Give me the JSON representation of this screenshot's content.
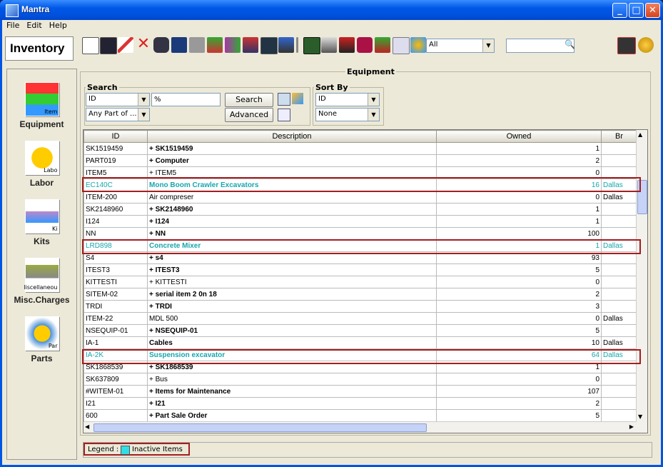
{
  "window": {
    "title": "Mantra",
    "min": "_",
    "max": "□",
    "close": "✕"
  },
  "menu": [
    "File",
    "Edit",
    "Help"
  ],
  "header": {
    "module_label": "Inventory",
    "filter_value": "All",
    "search_value": ""
  },
  "sidebar": [
    {
      "label": "Equipment",
      "icon_text": "Item",
      "icon": "equipment-icon"
    },
    {
      "label": "Labor",
      "icon_text": "Labo",
      "icon": "labor-icon"
    },
    {
      "label": "Kits",
      "icon_text": "Ki",
      "icon": "kits-icon"
    },
    {
      "label": "Misc.Charges",
      "icon_text": "liscellaneou",
      "icon": "misc-charges-icon"
    },
    {
      "label": "Parts",
      "icon_text": "Par",
      "icon": "parts-icon"
    }
  ],
  "panel": {
    "title": "Equipment",
    "search": {
      "title": "Search",
      "field": "ID",
      "value": "%",
      "match": "Any Part of ...",
      "search_button": "Search",
      "advanced_button": "Advanced"
    },
    "sort": {
      "title": "Sort By",
      "first": "ID",
      "second": "None"
    }
  },
  "table": {
    "columns": [
      "ID",
      "Description",
      "Owned",
      "Br"
    ],
    "rows": [
      {
        "id": "SK1519459",
        "desc": "+ SK1519459",
        "owned": "1",
        "br": "",
        "bold": true,
        "inactive": false
      },
      {
        "id": "PART019",
        "desc": "+ Computer",
        "owned": "2",
        "br": "",
        "bold": true,
        "inactive": false
      },
      {
        "id": "ITEM5",
        "desc": "+ ITEM5",
        "owned": "0",
        "br": "",
        "bold": false,
        "inactive": false
      },
      {
        "id": "EC140C",
        "desc": "Mono Boom Crawler Excavators",
        "owned": "16",
        "br": "Dallas",
        "bold": true,
        "inactive": true
      },
      {
        "id": "ITEM-200",
        "desc": "Air compreser",
        "owned": "0",
        "br": "Dallas",
        "bold": false,
        "inactive": false
      },
      {
        "id": "SK2148960",
        "desc": "+ SK2148960",
        "owned": "1",
        "br": "",
        "bold": true,
        "inactive": false
      },
      {
        "id": "I124",
        "desc": "+ I124",
        "owned": "1",
        "br": "",
        "bold": true,
        "inactive": false
      },
      {
        "id": "NN",
        "desc": "+ NN",
        "owned": "100",
        "br": "",
        "bold": true,
        "inactive": false
      },
      {
        "id": "LRD898",
        "desc": "Concrete Mixer",
        "owned": "1",
        "br": "Dallas",
        "bold": true,
        "inactive": true
      },
      {
        "id": "S4",
        "desc": "+ s4",
        "owned": "93",
        "br": "",
        "bold": true,
        "inactive": false
      },
      {
        "id": "ITEST3",
        "desc": "+ ITEST3",
        "owned": "5",
        "br": "",
        "bold": true,
        "inactive": false
      },
      {
        "id": "KITTESTI",
        "desc": "+ KITTESTI",
        "owned": "0",
        "br": "",
        "bold": false,
        "inactive": false
      },
      {
        "id": "SITEM-02",
        "desc": "+ serial item 2 0n 18",
        "owned": "2",
        "br": "",
        "bold": true,
        "inactive": false
      },
      {
        "id": "TRDI",
        "desc": "+ TRDI",
        "owned": "3",
        "br": "",
        "bold": true,
        "inactive": false
      },
      {
        "id": "ITEM-22",
        "desc": "MDL 500",
        "owned": "0",
        "br": "Dallas",
        "bold": false,
        "inactive": false
      },
      {
        "id": "NSEQUIP-01",
        "desc": "+ NSEQUIP-01",
        "owned": "5",
        "br": "",
        "bold": true,
        "inactive": false
      },
      {
        "id": "IA-1",
        "desc": "Cables",
        "owned": "10",
        "br": "Dallas",
        "bold": true,
        "inactive": false
      },
      {
        "id": "IA-2K",
        "desc": "Suspension excavator",
        "owned": "64",
        "br": "Dallas",
        "bold": true,
        "inactive": true
      },
      {
        "id": "SK1868539",
        "desc": "+ SK1868539",
        "owned": "1",
        "br": "",
        "bold": true,
        "inactive": false
      },
      {
        "id": "SK637809",
        "desc": "+ Bus",
        "owned": "0",
        "br": "",
        "bold": false,
        "inactive": false
      },
      {
        "id": "#WITEM-01",
        "desc": "+ Items for Maintenance",
        "owned": "107",
        "br": "",
        "bold": true,
        "inactive": false
      },
      {
        "id": "I21",
        "desc": "+ I21",
        "owned": "2",
        "br": "",
        "bold": true,
        "inactive": false
      },
      {
        "id": "600",
        "desc": "+ Part Sale Order",
        "owned": "5",
        "br": "",
        "bold": true,
        "inactive": false
      }
    ]
  },
  "legend": {
    "label": "Legend :",
    "item": "Inactive Items",
    "inactive_color": "#18a6ad",
    "swatch_color": "#33dde6"
  },
  "colors": {
    "highlight_border": "#a31f1f",
    "titlebar": "#0058e6"
  }
}
